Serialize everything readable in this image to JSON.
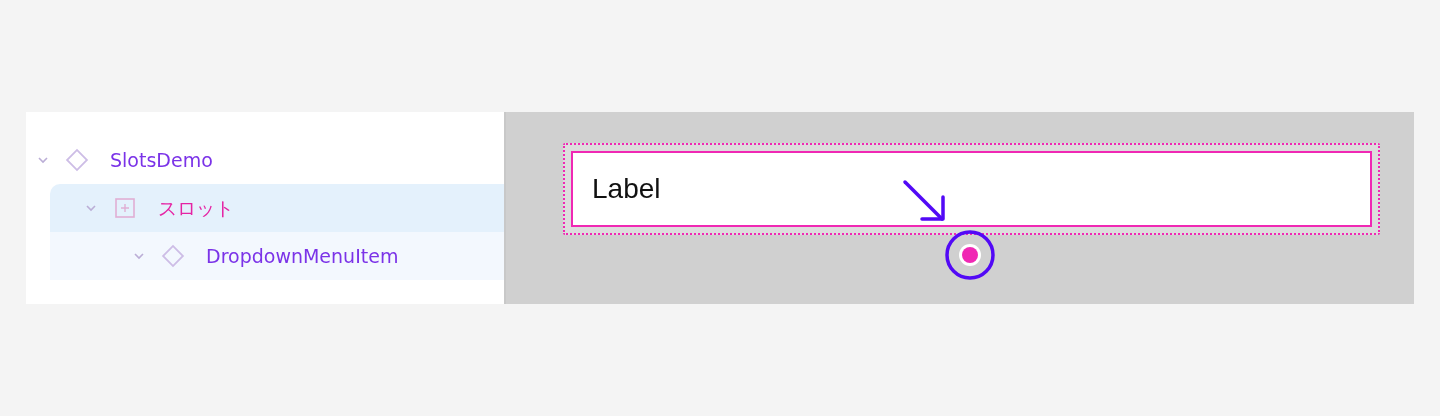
{
  "layers": [
    {
      "name": "SlotsDemo",
      "kind": "component",
      "expanded": true,
      "selected": false,
      "children": [
        {
          "name": "スロット",
          "kind": "slot",
          "expanded": true,
          "selected": true,
          "children": [
            {
              "name": "DropdownMenuItem",
              "kind": "component",
              "expanded": true,
              "selected": false
            }
          ]
        }
      ]
    }
  ],
  "canvas": {
    "element": {
      "text": "Label",
      "selected": true
    }
  }
}
